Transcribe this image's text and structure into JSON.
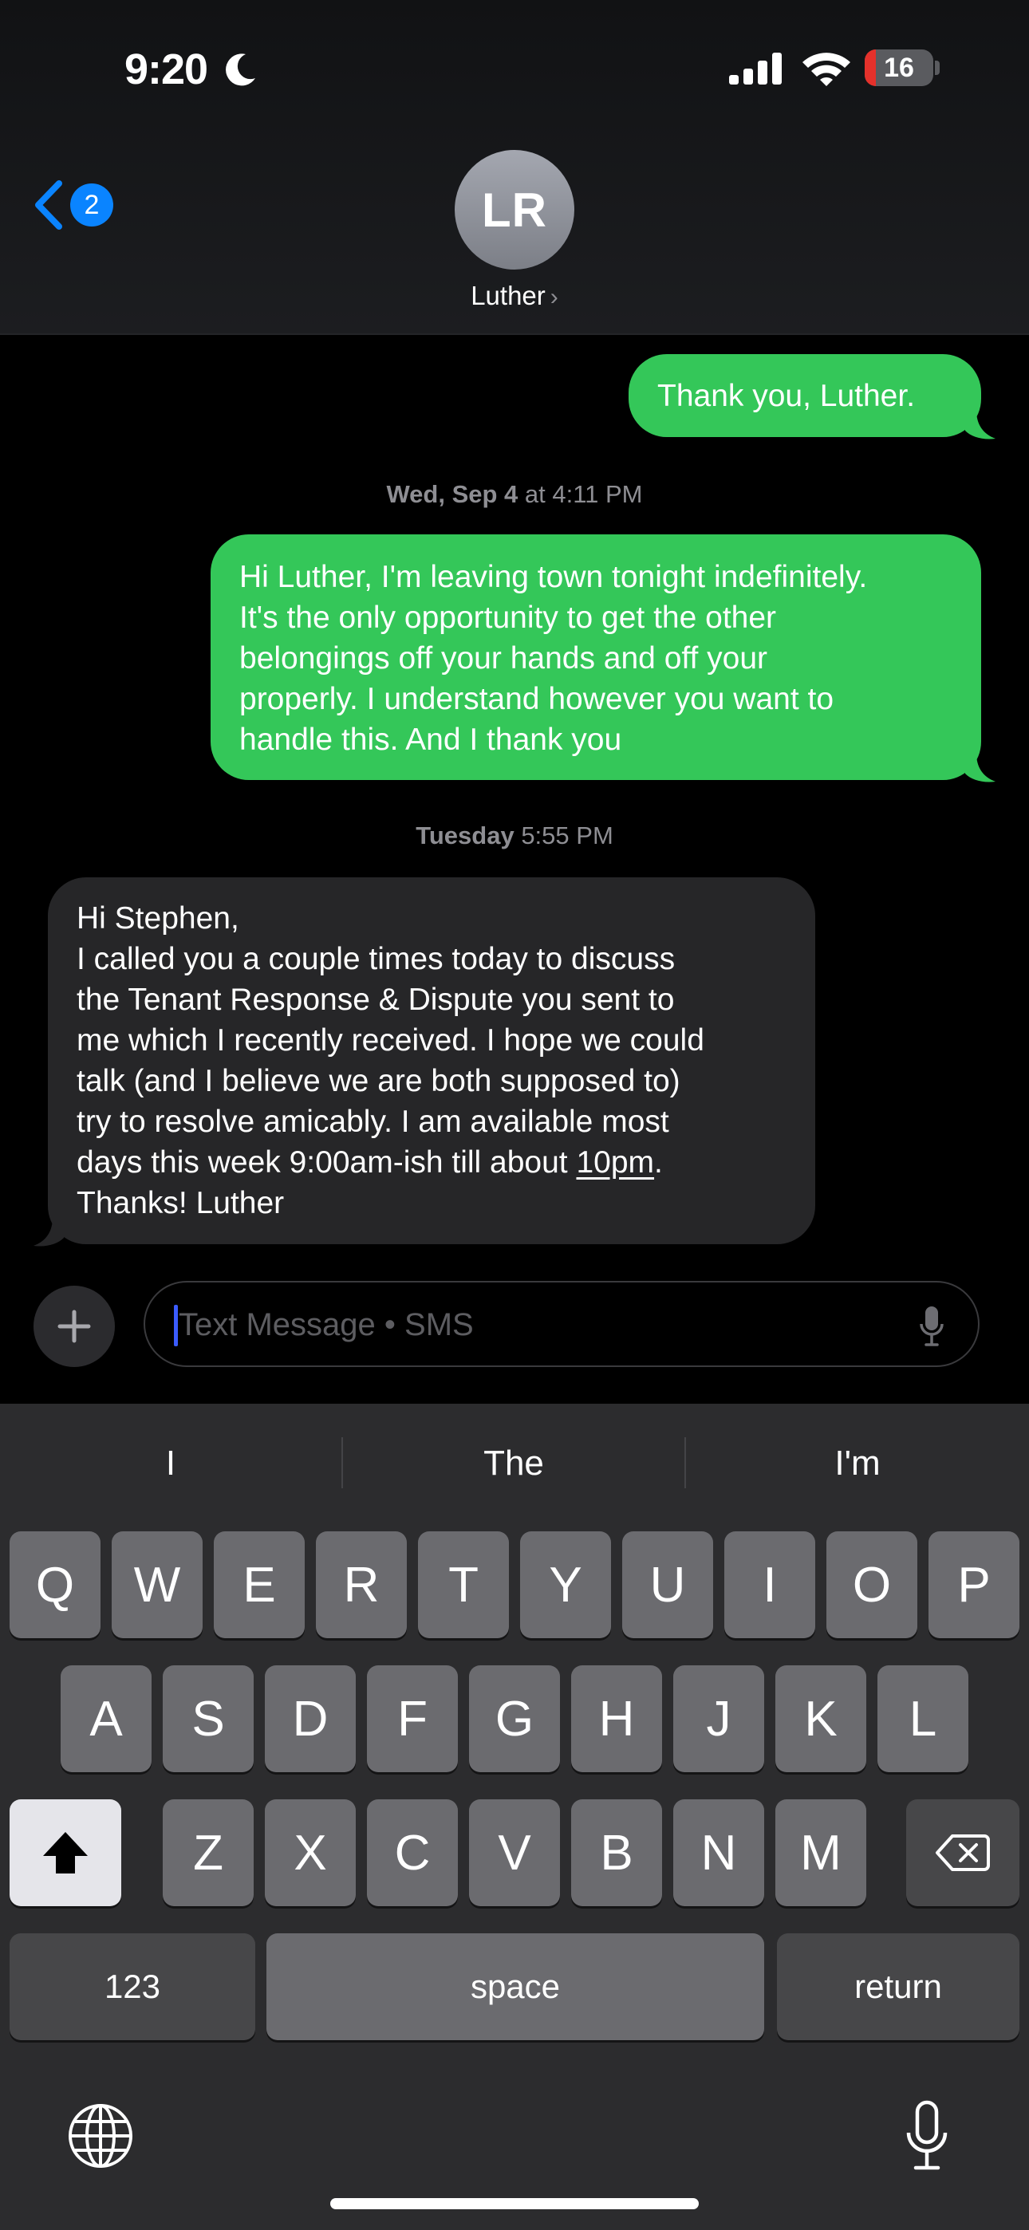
{
  "status_bar": {
    "time": "9:20",
    "focus_icon": "moon-icon",
    "signal_icon": "cellular-signal-icon",
    "wifi_icon": "wifi-icon",
    "battery_level": "16",
    "battery_percent": 16,
    "battery_color": "#e5312b"
  },
  "header": {
    "back_icon": "chevron-left-icon",
    "back_badge": "2",
    "avatar_initials": "LR",
    "contact_name": "Luther",
    "contact_chevron": "›"
  },
  "messages": [
    {
      "direction": "sent",
      "lines": [
        "Thank you, Luther."
      ]
    },
    {
      "type": "timestamp",
      "day": "Wed, Sep 4",
      "time": " at 4:11 PM"
    },
    {
      "direction": "sent",
      "lines": [
        "Hi Luther, I'm leaving town tonight indefinitely.",
        "It's the only opportunity to get the other",
        "belongings off your hands and off your",
        "properly. I understand however you want to",
        "handle this. And I thank you"
      ]
    },
    {
      "type": "timestamp",
      "day": "Tuesday",
      "time": " 5:55 PM"
    },
    {
      "direction": "received",
      "lines": [
        "Hi Stephen,",
        "I called you a couple times today to discuss",
        "the Tenant Response & Dispute you sent to",
        "me which I recently received. I hope we could",
        "talk (and I believe  we are both supposed to)",
        "try to resolve amicably. I am available most",
        "days this week 9:00am-ish till about ",
        "10pm",
        ".",
        "Thanks! Luther"
      ]
    }
  ],
  "compose": {
    "plus_icon": "plus-icon",
    "placeholder": "Text Message • SMS",
    "value": "",
    "mic_icon": "microphone-icon"
  },
  "keyboard": {
    "suggestions": [
      "I",
      "The",
      "I'm"
    ],
    "row1": [
      "Q",
      "W",
      "E",
      "R",
      "T",
      "Y",
      "U",
      "I",
      "O",
      "P"
    ],
    "row2": [
      "A",
      "S",
      "D",
      "F",
      "G",
      "H",
      "J",
      "K",
      "L"
    ],
    "row3": [
      "Z",
      "X",
      "C",
      "V",
      "B",
      "N",
      "M"
    ],
    "shift_icon": "shift-icon",
    "delete_icon": "backspace-icon",
    "numbers_label": "123",
    "space_label": "space",
    "return_label": "return",
    "globe_icon": "globe-icon",
    "dictation_icon": "microphone-icon"
  },
  "colors": {
    "sent_bubble": "#34c759",
    "received_bubble": "#262628",
    "accent": "#0a84ff"
  }
}
